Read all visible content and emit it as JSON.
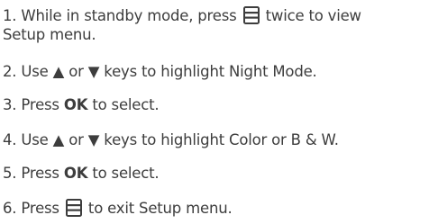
{
  "steps": [
    {
      "num": "1.",
      "before": "While in standby mode, press",
      "after": "twice to view",
      "line2": "Setup menu."
    },
    {
      "num": "2.",
      "before": "Use",
      "up": "▲",
      "or": "or",
      "down": "▼",
      "after": "keys to highlight Night Mode."
    },
    {
      "num": "3.",
      "before": "Press",
      "key": "OK",
      "after": "to select."
    },
    {
      "num": "4.",
      "before": "Use",
      "up": "▲",
      "or": "or",
      "down": "▼",
      "after": "keys to highlight Color or B & W."
    },
    {
      "num": "5.",
      "before": "Press",
      "key": "OK",
      "after": "to select."
    },
    {
      "num": "6.",
      "before": "Press",
      "after": "to exit Setup menu."
    }
  ],
  "icons": {
    "menu": "menu-key-icon"
  },
  "colors": {
    "text": "#3d3d3d",
    "icon": "#3d3d3d"
  }
}
